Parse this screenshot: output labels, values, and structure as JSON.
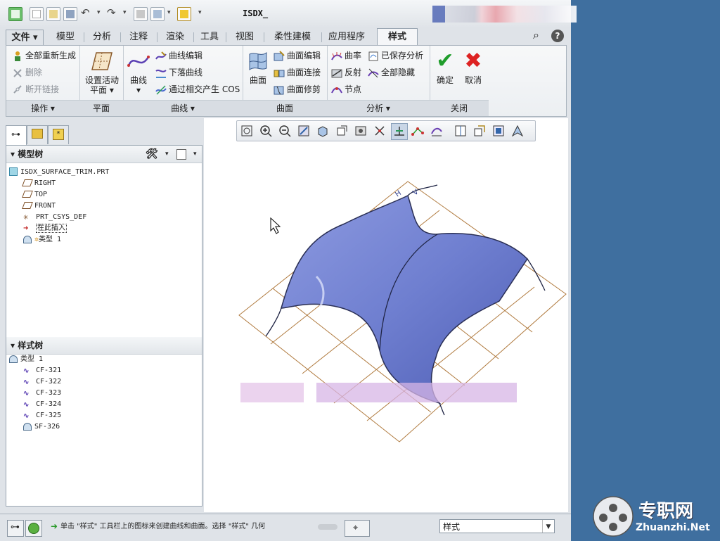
{
  "window": {
    "title": "ISDX_"
  },
  "tabs": [
    {
      "label": "文件"
    },
    {
      "label": "模型"
    },
    {
      "label": "分析"
    },
    {
      "label": "注释"
    },
    {
      "label": "渲染"
    },
    {
      "label": "工具"
    },
    {
      "label": "视图"
    },
    {
      "label": "柔性建模"
    },
    {
      "label": "应用程序"
    },
    {
      "label": "样式"
    }
  ],
  "ribbon": {
    "operations": {
      "items": [
        "全部重新生成",
        "删除",
        "断开链接"
      ],
      "footer": "操作"
    },
    "plane": {
      "button": "设置活动",
      "button2": "平面",
      "footer": "平面"
    },
    "curves": {
      "big": "曲线",
      "items": [
        "曲线编辑",
        "下落曲线",
        "通过相交产生 COS"
      ],
      "footer": "曲线"
    },
    "surface": {
      "big": "曲面",
      "items": [
        "曲面编辑",
        "曲面连接",
        "曲面修剪"
      ],
      "footer": "曲面"
    },
    "analysis": {
      "items": [
        "曲率",
        "反射",
        "节点",
        "已保存分析",
        "全部隐藏"
      ],
      "footer": "分析"
    },
    "close": {
      "ok": "确定",
      "cancel": "取消",
      "footer": "关闭"
    }
  },
  "model_tree": {
    "title": "模型树",
    "items": [
      "ISDX_SURFACE_TRIM.PRT",
      "RIGHT",
      "TOP",
      "FRONT",
      "PRT_CSYS_DEF",
      "在此插入",
      "类型 1"
    ]
  },
  "style_tree": {
    "title": "样式树",
    "items": [
      "类型 1",
      "CF-321",
      "CF-322",
      "CF-323",
      "CF-324",
      "CF-325",
      "SF-326"
    ]
  },
  "status": {
    "message": "单击 \"样式\" 工具栏上的图标来创建曲线和曲面。选择 \"样式\" 几何",
    "filter": "样式"
  },
  "watermark": {
    "cn": "专职网",
    "en": "Zhuanzhi.Net"
  },
  "colors": {
    "surface": "#6f7fd0",
    "grid": "#b07a3e",
    "desktop": "#3f6f9f"
  }
}
